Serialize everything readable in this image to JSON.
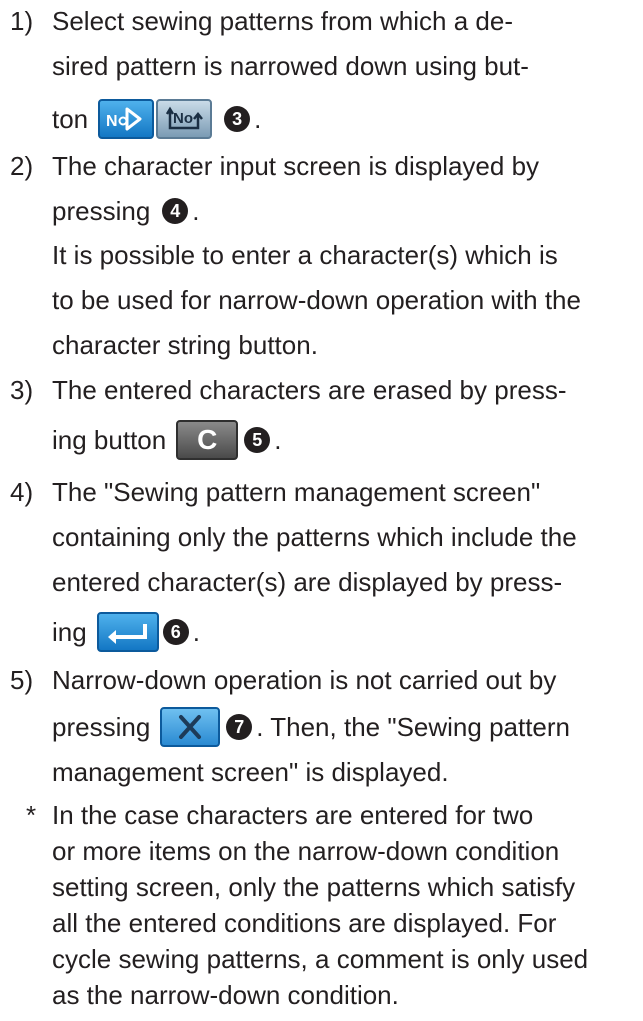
{
  "items": [
    {
      "num": "1)",
      "lines": [
        "Select sewing patterns from which a de-",
        "sired pattern is narrowed down using but-"
      ],
      "before_button": "ton",
      "marker": "❸",
      "after": "."
    },
    {
      "num": "2)",
      "line1": "The character input screen is displayed by",
      "line2_text": "pressing",
      "marker": "❹",
      "after": ".",
      "extra_lines": [
        "It is possible to enter a character(s) which is",
        "to be used for narrow-down operation with the",
        "character string button."
      ]
    },
    {
      "num": "3)",
      "line1": "The entered characters are erased by press-",
      "before_button": "ing button",
      "button_label": "C",
      "marker": "❺",
      "after": "."
    },
    {
      "num": "4)",
      "lines": [
        "The \"Sewing pattern management screen\"",
        "containing only the patterns which include the",
        "entered character(s) are displayed by press-"
      ],
      "before_button": "ing",
      "marker": "❻",
      "after": "."
    },
    {
      "num": "5)",
      "line1": "Narrow-down operation is not carried out by",
      "before_button": "pressing",
      "marker": "❼",
      "after_button": ". Then, the \"Sewing pattern",
      "line3": "management screen\" is displayed."
    }
  ],
  "note": {
    "marker": "*",
    "lines": [
      "In the case characters are entered for two",
      "or more items on the narrow-down condition",
      "setting screen, only the patterns which satisfy",
      "all the entered conditions are displayed. For",
      "cycle sewing patterns, a comment is only used",
      "as the narrow-down condition."
    ]
  },
  "colors": {
    "text": "#231f20",
    "button_blue": "#1e88d6",
    "button_gray": "#5a5a5a",
    "button_x": "#3a8fd0"
  },
  "icons": [
    "number-forward-icon",
    "number-cycle-icon",
    "clear-c-icon",
    "enter-arrow-icon",
    "cancel-x-icon"
  ]
}
